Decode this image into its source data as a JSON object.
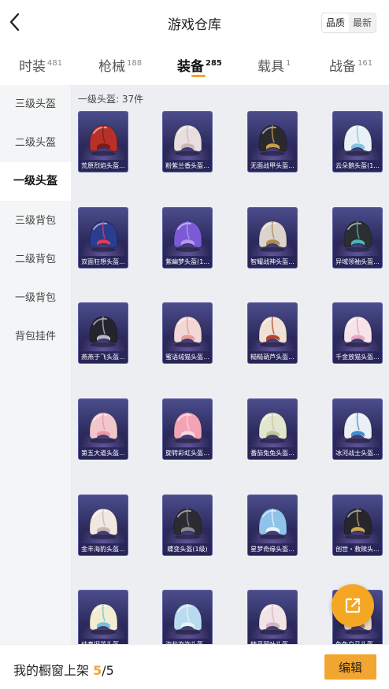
{
  "header": {
    "title": "游戏仓库",
    "sort": {
      "options": [
        "品质",
        "最新"
      ],
      "selected": "品质"
    }
  },
  "tabs": [
    {
      "label": "时装",
      "count": "481"
    },
    {
      "label": "枪械",
      "count": "188"
    },
    {
      "label": "装备",
      "count": "285",
      "active": true
    },
    {
      "label": "载具",
      "count": "1"
    },
    {
      "label": "战备",
      "count": "161"
    }
  ],
  "sidebar": {
    "items": [
      {
        "label": "三级头盔"
      },
      {
        "label": "二级头盔"
      },
      {
        "label": "一级头盔",
        "active": true
      },
      {
        "label": "三级背包"
      },
      {
        "label": "二级背包"
      },
      {
        "label": "一级背包"
      },
      {
        "label": "背包挂件"
      }
    ]
  },
  "content": {
    "section_title": "一级头盔: 37件",
    "items": [
      {
        "label": "荒原烈焰头盔...",
        "color": "#b8302a",
        "accent": "#7a1b18"
      },
      {
        "label": "粉紫兰香头盔...",
        "color": "#e9dede",
        "accent": "#c9b7b7"
      },
      {
        "label": "无面战甲头盔...",
        "color": "#2a2a2e",
        "accent": "#c9a04a"
      },
      {
        "label": "云朵鹅头盔(1...",
        "color": "#e8f2f6",
        "accent": "#7fc6e4"
      },
      {
        "label": "双面狂想头盔...",
        "color": "#2a3d8f",
        "accent": "#e03a5a"
      },
      {
        "label": "紫幽梦头盔(1...",
        "color": "#7b5ad6",
        "accent": "#b39af0"
      },
      {
        "label": "智耀战神头盔...",
        "color": "#dad4cc",
        "accent": "#b08a4e"
      },
      {
        "label": "异域领袖头盔...",
        "color": "#2a2f33",
        "accent": "#4bb7b2"
      },
      {
        "label": "燕燕于飞头盔...",
        "color": "#23242c",
        "accent": "#b8b8c8"
      },
      {
        "label": "蜜语绒猫头盔...",
        "color": "#f3d6d6",
        "accent": "#e79a9a"
      },
      {
        "label": "糙糙葫芦头盔...",
        "color": "#efe1d6",
        "accent": "#b8442c"
      },
      {
        "label": "千金放猫头盔...",
        "color": "#f7e3ea",
        "accent": "#e7a5bd"
      },
      {
        "label": "第五大道头盔...",
        "color": "#f2c7cc",
        "accent": "#e898a4"
      },
      {
        "label": "旋转彩虹头盔...",
        "color": "#f4a3b4",
        "accent": "#f8d8e0"
      },
      {
        "label": "番茄兔兔头盔...",
        "color": "#e3e6cf",
        "accent": "#c2c79a"
      },
      {
        "label": "冰河战士头盔...",
        "color": "#eaf0f5",
        "accent": "#3f8fd2"
      },
      {
        "label": "金丰海豹头盔...",
        "color": "#f1e8e2",
        "accent": "#c9b9ac"
      },
      {
        "label": "蝶变头盔(1级)",
        "color": "#2b2b31",
        "accent": "#8a8a96"
      },
      {
        "label": "星梦奇缘头盔...",
        "color": "#8fc3ea",
        "accent": "#eaf4fb"
      },
      {
        "label": "创世・救赎头...",
        "color": "#26262c",
        "accent": "#d0a752"
      },
      {
        "label": "纯真旧花头盔...",
        "color": "#f2ecd2",
        "accent": "#6cc4e6"
      },
      {
        "label": "海盐泡泡头盔...",
        "color": "#b9dbef",
        "accent": "#e6f3fa"
      },
      {
        "label": "精灵琴叶头盔...",
        "color": "#f1e3e7",
        "accent": "#d8b3bd"
      },
      {
        "label": "兔兔白马头盔...",
        "color": "#ead6c3",
        "accent": "#a67c54"
      }
    ]
  },
  "fab": {
    "icon": "share-external-icon"
  },
  "bottom_bar": {
    "label": "我的橱窗上架",
    "count": "5",
    "separator": "/",
    "total": "5",
    "edit_label": "编辑"
  }
}
